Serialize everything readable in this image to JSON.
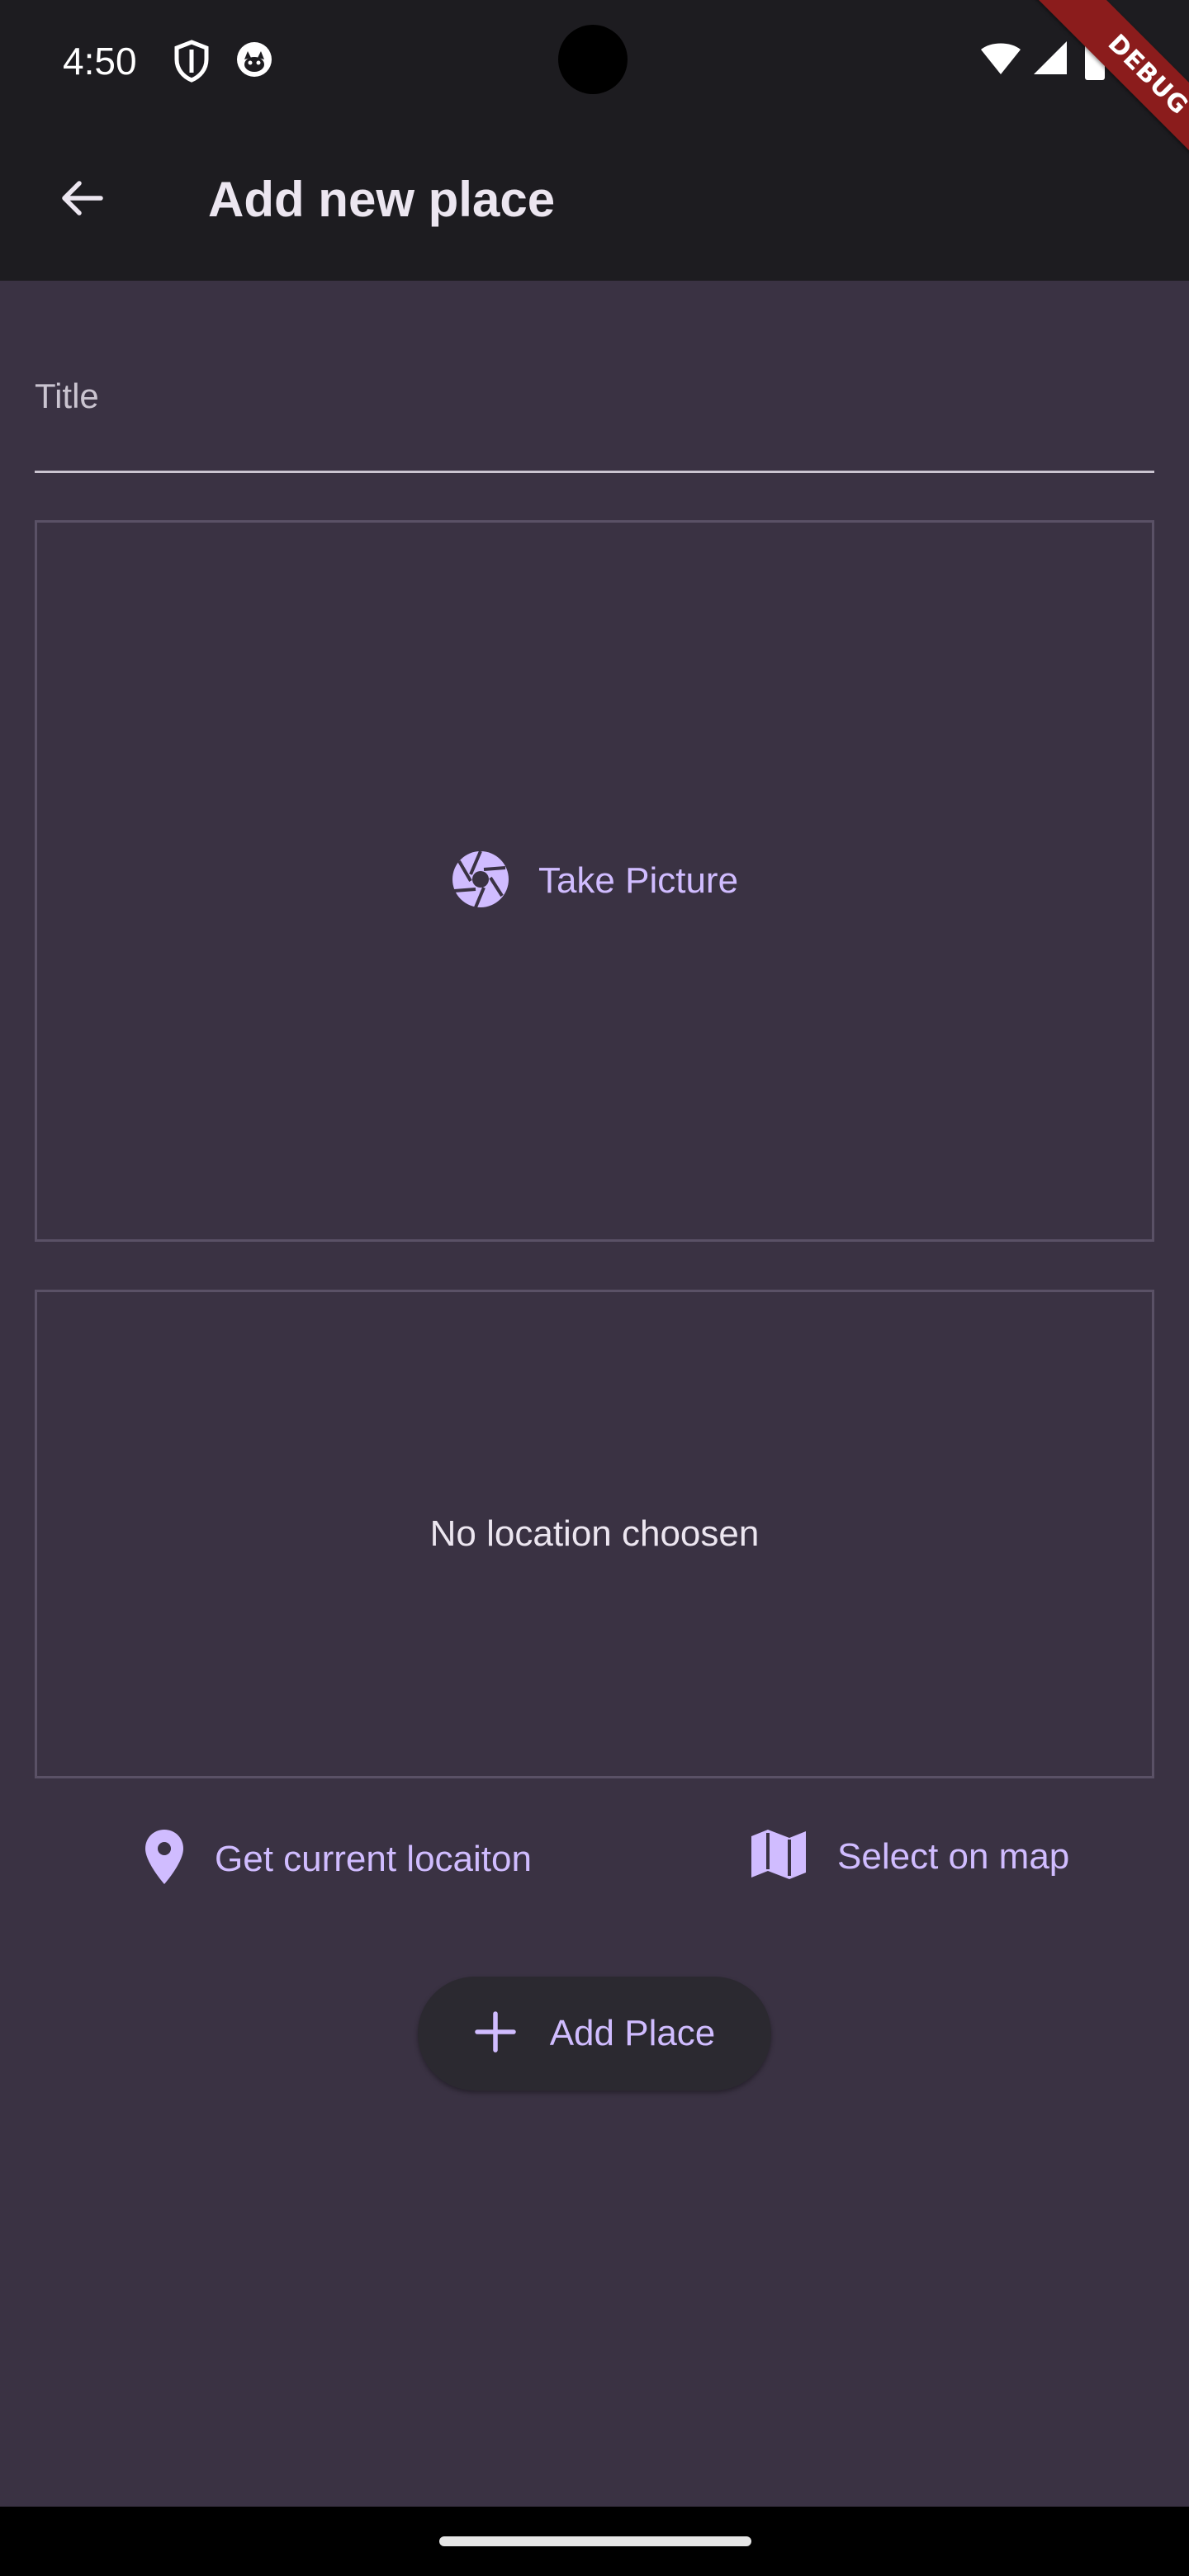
{
  "status_bar": {
    "time": "4:50"
  },
  "debug_banner": {
    "label": "DEBUG"
  },
  "app_bar": {
    "title": "Add new place",
    "back_icon": "arrow-back-icon"
  },
  "form": {
    "title_field": {
      "label": "Title",
      "value": ""
    },
    "picture": {
      "button_label": "Take Picture",
      "icon": "camera-shutter-icon"
    },
    "location": {
      "empty_text": "No location choosen",
      "current_location_label": "Get current locaiton",
      "current_location_icon": "location-pin-icon",
      "select_on_map_label": "Select on map",
      "select_on_map_icon": "map-icon"
    },
    "submit": {
      "label": "Add Place",
      "icon": "plus-icon"
    }
  },
  "colors": {
    "background": "#3a3243",
    "app_bar": "#1d1c20",
    "accent": "#d0bcff",
    "border": "#5a5166",
    "text": "#ece6f0",
    "debug": "#8b1c1c"
  }
}
